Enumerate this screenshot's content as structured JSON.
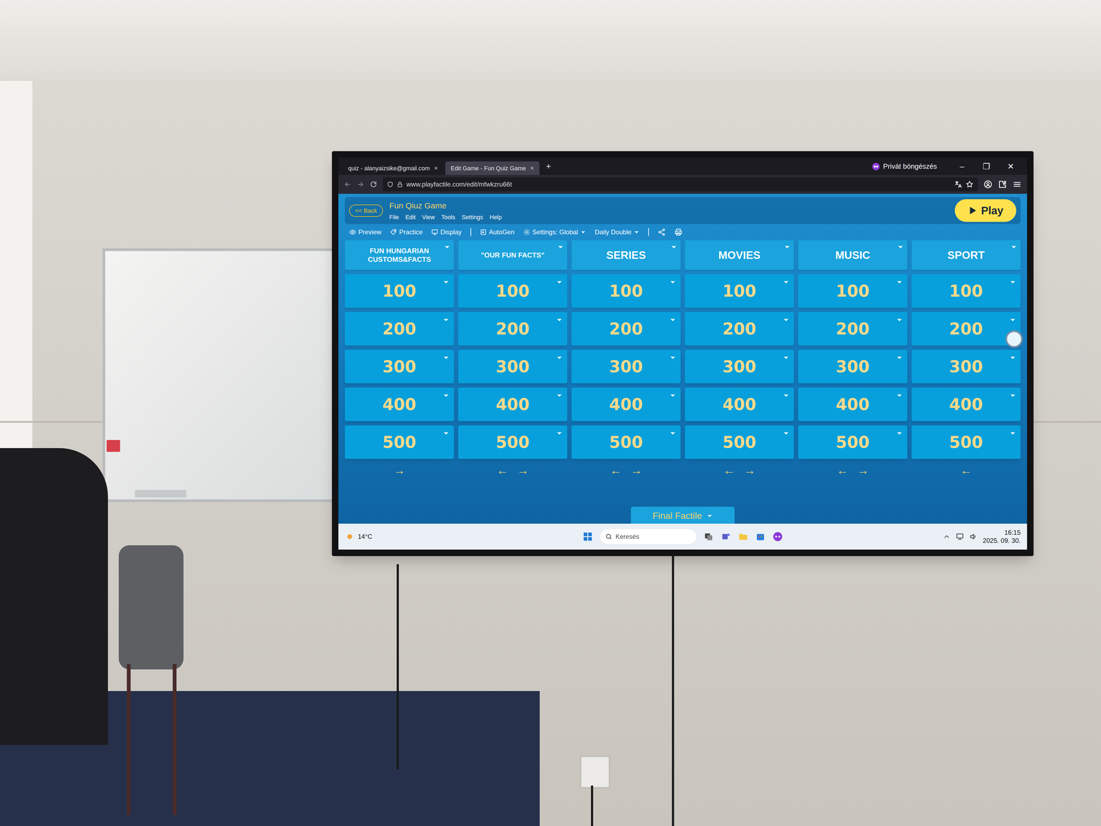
{
  "browser": {
    "tabs": [
      {
        "label": "quiz - alanyaizsike@gmail.com",
        "close": "×",
        "selected": false
      },
      {
        "label": "Edit Game - Fun Quiz Game",
        "close": "×",
        "selected": true
      }
    ],
    "new_tab": "+",
    "url": "www.playfactile.com/edit/mfwkzru66t",
    "private_label": "Privát böngészés",
    "window_controls": [
      "–",
      "❐",
      "✕"
    ]
  },
  "app": {
    "back": "<< Back",
    "title": "Fun Qiuz Game",
    "menu": [
      "File",
      "Edit",
      "View",
      "Tools",
      "Settings",
      "Help"
    ],
    "toolbar": [
      "Preview",
      "Practice",
      "Display",
      "AutoGen",
      "Settings: Global",
      "Daily Double"
    ],
    "play": "Play"
  },
  "board": {
    "columns": [
      {
        "title": "FUN HUNGARIAN CUSTOMS&FACTS",
        "tiles": [
          "100",
          "200",
          "300",
          "400",
          "500"
        ],
        "arrows": [
          "→"
        ]
      },
      {
        "title": "\"OUR FUN FACTS\"",
        "tiles": [
          "100",
          "200",
          "300",
          "400",
          "500"
        ],
        "arrows": [
          "←",
          "→"
        ]
      },
      {
        "title": "SERIES",
        "tiles": [
          "100",
          "200",
          "300",
          "400",
          "500"
        ],
        "arrows": [
          "←",
          "→"
        ]
      },
      {
        "title": "MOVIES",
        "tiles": [
          "100",
          "200",
          "300",
          "400",
          "500"
        ],
        "arrows": [
          "←",
          "→"
        ]
      },
      {
        "title": "MUSIC",
        "tiles": [
          "100",
          "200",
          "300",
          "400",
          "500"
        ],
        "arrows": [
          "←",
          "→"
        ]
      },
      {
        "title": "SPORT",
        "tiles": [
          "100",
          "200",
          "300",
          "400",
          "500"
        ],
        "arrows": [
          "←"
        ]
      }
    ],
    "final": "Final Factile"
  },
  "taskbar": {
    "weather": "14°C",
    "search": "Keresés",
    "time": "16:15",
    "date": "2025. 09. 30."
  }
}
